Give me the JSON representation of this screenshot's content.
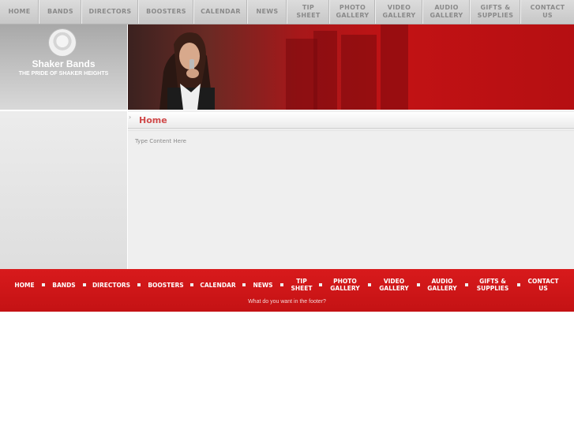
{
  "top_nav": {
    "items": [
      {
        "label": "HOME"
      },
      {
        "label": "BANDS"
      },
      {
        "label": "DIRECTORS"
      },
      {
        "label": "BOOSTERS"
      },
      {
        "label": "CALENDAR"
      },
      {
        "label": "NEWS"
      },
      {
        "label": "TIP\nSHEET"
      },
      {
        "label": "PHOTO\nGALLERY"
      },
      {
        "label": "VIDEO\nGALLERY"
      },
      {
        "label": "AUDIO\nGALLERY"
      },
      {
        "label": "GIFTS &\nSUPPLIES"
      },
      {
        "label": "CONTACT\nUS"
      }
    ]
  },
  "brand": {
    "title": "Shaker Bands",
    "tagline": "THE PRIDE OF SHAKER HEIGHTS"
  },
  "main": {
    "breadcrumb": "Home",
    "body_text": "Type Content Here"
  },
  "footer": {
    "items": [
      {
        "label": "HOME"
      },
      {
        "label": "BANDS"
      },
      {
        "label": "DIRECTORS"
      },
      {
        "label": "BOOSTERS"
      },
      {
        "label": "CALENDAR"
      },
      {
        "label": "NEWS"
      },
      {
        "label": "TIP\nSHEET"
      },
      {
        "label": "PHOTO\nGALLERY"
      },
      {
        "label": "VIDEO\nGALLERY"
      },
      {
        "label": "AUDIO\nGALLERY"
      },
      {
        "label": "GIFTS &\nSUPPLIES"
      },
      {
        "label": "CONTACT\nUS"
      }
    ],
    "note": "What do you want in the footer?"
  },
  "colors": {
    "accent_red": "#c41214",
    "breadcrumb_red": "#d04a4a",
    "nav_gray": "#c7c7c7"
  },
  "icons": {
    "logo": "band-logo-icon",
    "breadcrumb_arrow": "chevron-right-icon",
    "footer_separator": "square-bullet-icon"
  }
}
